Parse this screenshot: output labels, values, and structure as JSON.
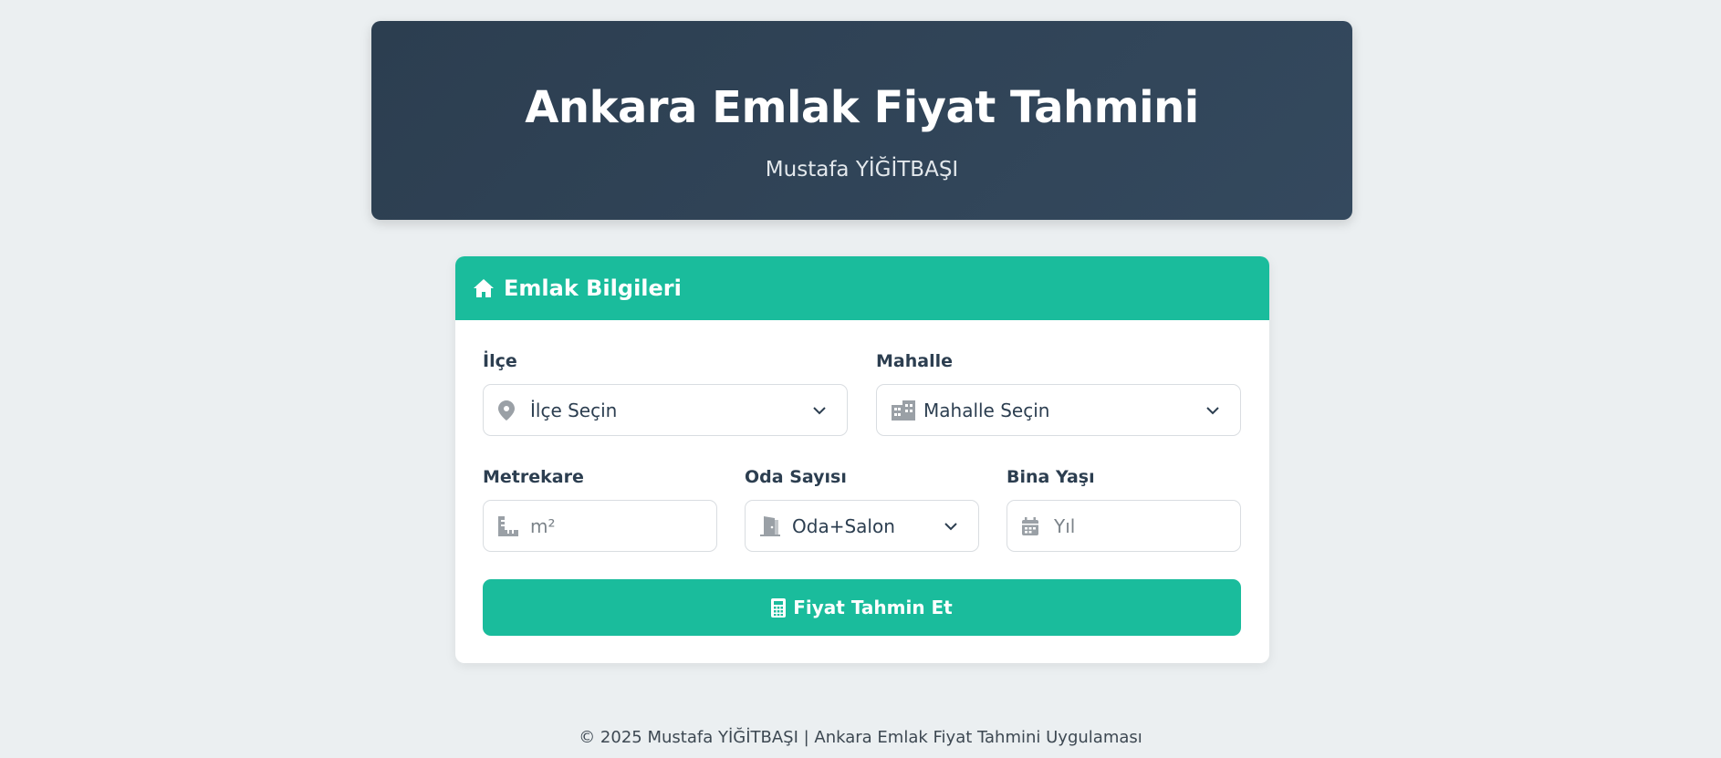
{
  "header": {
    "title": "Ankara Emlak Fiyat Tahmini",
    "author": "Mustafa YİĞİTBAŞI"
  },
  "card": {
    "title": "Emlak Bilgileri",
    "title_icon": "home-icon",
    "fields": {
      "ilce": {
        "label": "İlçe",
        "value": "İlçe Seçin",
        "icon": "map-marker-icon"
      },
      "mahalle": {
        "label": "Mahalle",
        "value": "Mahalle Seçin",
        "icon": "city-icon"
      },
      "metrekare": {
        "label": "Metrekare",
        "placeholder": "m²",
        "icon": "ruler-icon"
      },
      "oda": {
        "label": "Oda Sayısı",
        "value": "Oda+Salon",
        "icon": "door-icon"
      },
      "bina_yasi": {
        "label": "Bina Yaşı",
        "placeholder": "Yıl",
        "icon": "calendar-icon"
      }
    },
    "submit_label": "Fiyat Tahmin Et",
    "submit_icon": "calculator-icon"
  },
  "footer": {
    "text": "© 2025 Mustafa YİĞİTBAŞI | Ankara Emlak Fiyat Tahmini Uygulaması"
  },
  "colors": {
    "header_bg": "#2c3e50",
    "accent": "#1abc9c",
    "page_bg": "#ebeff1"
  }
}
